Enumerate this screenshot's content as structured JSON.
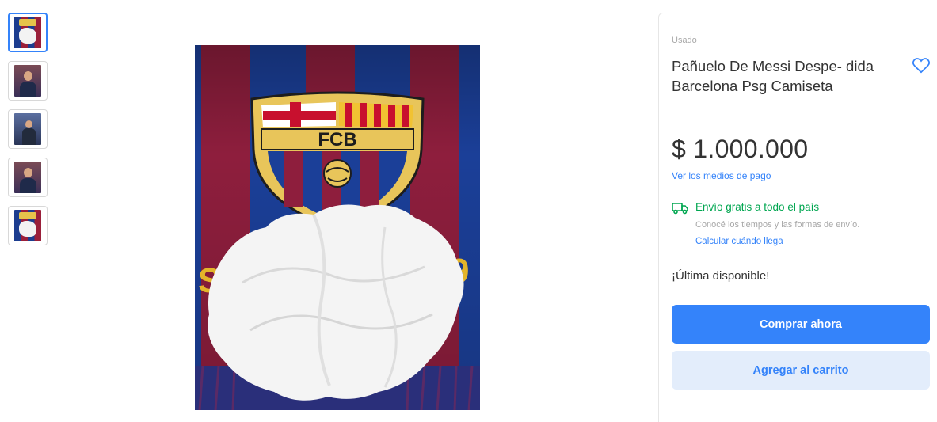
{
  "gallery": {
    "thumbnails": [
      {
        "icon": "scarf-tissue-thumbnail"
      },
      {
        "icon": "messi-thumbnail"
      },
      {
        "icon": "messi-stage-thumbnail"
      },
      {
        "icon": "messi-press-thumbnail"
      },
      {
        "icon": "scarf-tissue-thumbnail"
      }
    ],
    "main_image": {
      "icon": "fcb-scarf-with-tissue-photo",
      "crest_text": "FCB"
    }
  },
  "product": {
    "condition": "Usado",
    "title": "Pañuelo De Messi Despe- dida Barcelona Psg Camiseta",
    "price": "$ 1.000.000",
    "payment_link": "Ver los medios de pago",
    "shipping": {
      "title": "Envío gratis a todo el país",
      "subtitle": "Conocé los tiempos y las formas de envío.",
      "link": "Calcular cuándo llega"
    },
    "stock": "¡Última disponible!",
    "buy_button": "Comprar ahora",
    "cart_button": "Agregar al carrito"
  },
  "colors": {
    "accent": "#3483fa",
    "shipping_green": "#00a650",
    "secondary_button_bg": "#e3edfb"
  }
}
